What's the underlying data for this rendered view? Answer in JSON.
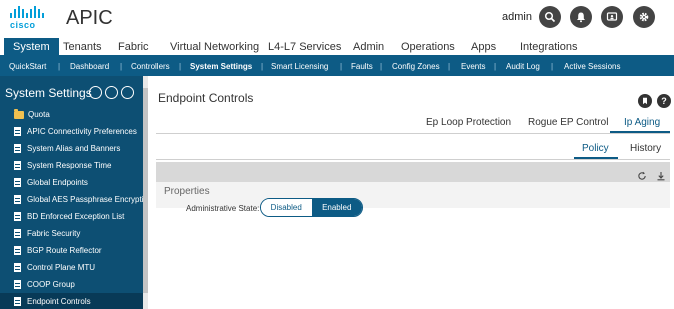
{
  "header": {
    "logo_text": "cisco",
    "app_title": "APIC",
    "username": "admin",
    "icons": [
      "search-icon",
      "bell-icon",
      "tasks-icon",
      "gear-icon"
    ]
  },
  "main_tabs": [
    "System",
    "Tenants",
    "Fabric",
    "Virtual Networking",
    "L4-L7 Services",
    "Admin",
    "Operations",
    "Apps",
    "Integrations"
  ],
  "main_tab_active": "System",
  "subnav": [
    "QuickStart",
    "Dashboard",
    "Controllers",
    "System Settings",
    "Smart Licensing",
    "Faults",
    "Config Zones",
    "Events",
    "Audit Log",
    "Active Sessions"
  ],
  "subnav_active": "System Settings",
  "sidebar": {
    "title": "System Settings",
    "items": [
      {
        "label": "Quota",
        "type": "folder"
      },
      {
        "label": "APIC Connectivity Preferences",
        "type": "doc"
      },
      {
        "label": "System Alias and Banners",
        "type": "doc"
      },
      {
        "label": "System Response Time",
        "type": "doc"
      },
      {
        "label": "Global Endpoints",
        "type": "doc"
      },
      {
        "label": "Global AES Passphrase Encryptio",
        "type": "doc"
      },
      {
        "label": "BD Enforced Exception List",
        "type": "doc"
      },
      {
        "label": "Fabric Security",
        "type": "doc"
      },
      {
        "label": "BGP Route Reflector",
        "type": "doc"
      },
      {
        "label": "Control Plane MTU",
        "type": "doc"
      },
      {
        "label": "COOP Group",
        "type": "doc"
      },
      {
        "label": "Endpoint Controls",
        "type": "doc",
        "selected": true
      }
    ]
  },
  "content": {
    "title": "Endpoint Controls",
    "tabs": [
      "Ep Loop Protection",
      "Rogue EP Control",
      "Ip Aging"
    ],
    "active_tab": "Ip Aging",
    "subtabs": [
      "Policy",
      "History"
    ],
    "active_subtab": "Policy",
    "section": "Properties",
    "field_label": "Administrative State:",
    "state_options": [
      "Disabled",
      "Enabled"
    ],
    "state_value": "Enabled"
  },
  "colors": {
    "primary": "#0d5b85",
    "sidebar": "#0d4f73",
    "cisco_blue": "#049fd9"
  }
}
